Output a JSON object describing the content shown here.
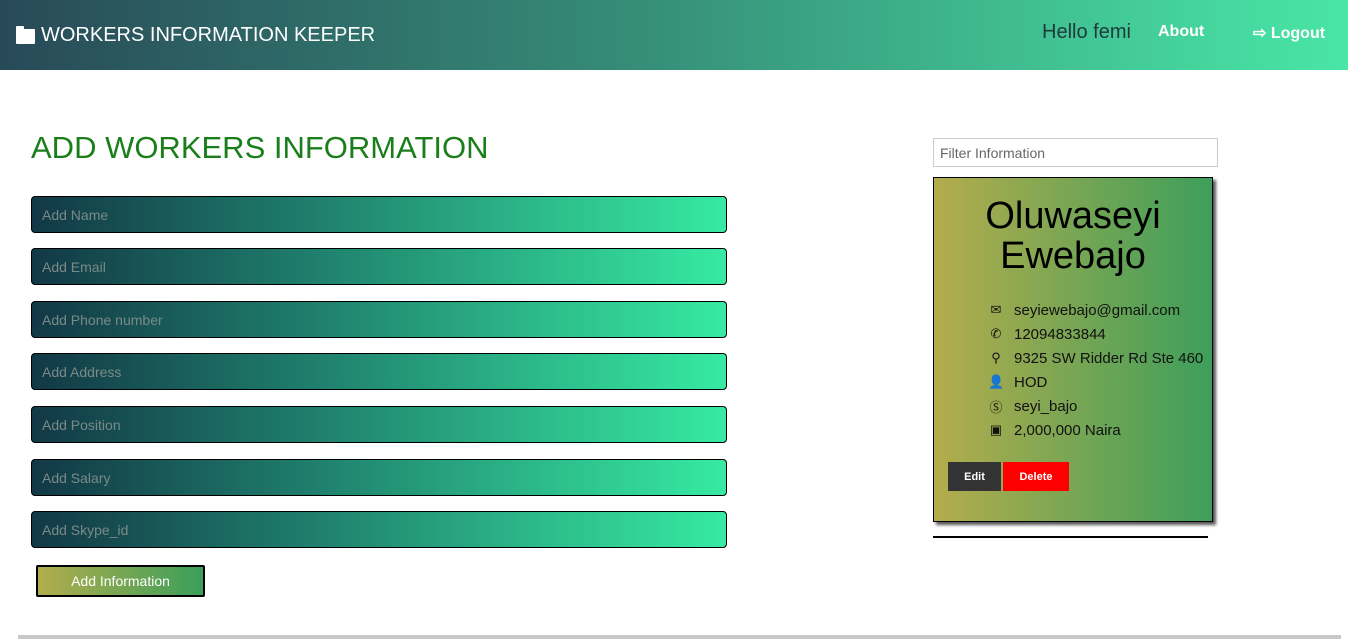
{
  "nav": {
    "brand": "WORKERS INFORMATION KEEPER",
    "greeting": "Hello femi",
    "about": "About",
    "logout": "Logout"
  },
  "form": {
    "title": "ADD WORKERS INFORMATION",
    "fields": [
      "Add Name",
      "Add Email",
      "Add Phone number",
      "Add Address",
      "Add Position",
      "Add Salary",
      "Add Skype_id"
    ],
    "submit": "Add Information"
  },
  "filter": {
    "placeholder": "Filter Information"
  },
  "card": {
    "first_name": "Oluwaseyi",
    "last_name": "Ewebajo",
    "email": "seyiewebajo@gmail.com",
    "phone": "12094833844",
    "address": "9325 SW Ridder Rd Ste 460",
    "position": "HOD",
    "skype": "seyi_bajo",
    "salary": "2,000,000 Naira",
    "edit": "Edit",
    "delete": "Delete"
  },
  "colors": {
    "form_title": "#1a7f1a",
    "delete": "#ff0000",
    "edit": "#333333"
  }
}
